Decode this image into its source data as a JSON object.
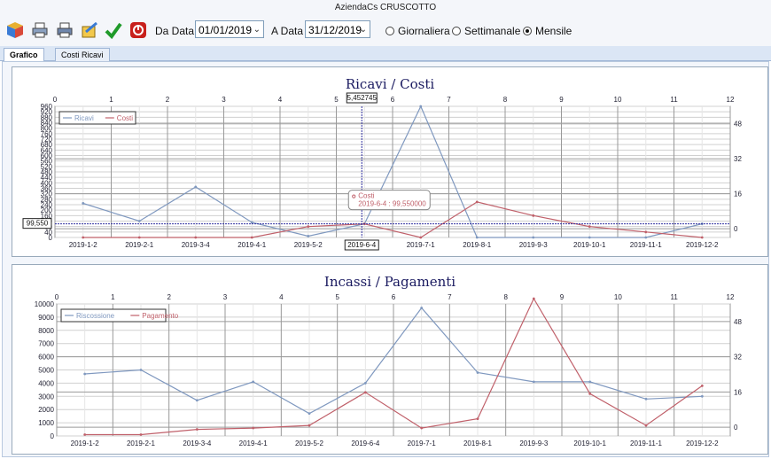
{
  "window": {
    "title": "AziendaCs CRUSCOTTO"
  },
  "toolbar": {
    "icons": [
      "cube-icon",
      "print-icon",
      "print-preview-icon",
      "export-icon",
      "confirm-check-icon",
      "power-icon"
    ],
    "da_data_label": "Da Data",
    "da_data_value": "01/01/2019",
    "a_data_label": "A Data",
    "a_data_value": "31/12/2019",
    "radio_giornaliera": "Giornaliera",
    "radio_settimanale": "Settimanale",
    "radio_mensile": "Mensile",
    "selected_period": "Mensile"
  },
  "tabs": [
    {
      "label": "Grafico",
      "active": true
    },
    {
      "label": "Costi Ricavi",
      "active": false
    }
  ],
  "colors": {
    "series_a": "#7f98bf",
    "series_b": "#c0606a",
    "grid": "#d0d0d0",
    "cursor": "#3030a0"
  },
  "chart_data": [
    {
      "type": "line",
      "title": "Ricavi / Costi",
      "categories": [
        "2019-1-2",
        "2019-2-1",
        "2019-3-4",
        "2019-4-1",
        "2019-5-2",
        "2019-6-4",
        "2019-7-1",
        "2019-8-1",
        "2019-9-3",
        "2019-10-1",
        "2019-11-1",
        "2019-12-2"
      ],
      "series": [
        {
          "name": "Ricavi",
          "values": [
            250,
            120,
            370,
            110,
            10,
            100,
            960,
            0,
            0,
            0,
            0,
            100
          ]
        },
        {
          "name": "Costi",
          "values": [
            0,
            0,
            0,
            0,
            80,
            99.55,
            0,
            260,
            160,
            80,
            40,
            0
          ]
        }
      ],
      "ylim": [
        0,
        960
      ],
      "yticks": [
        0,
        40,
        80,
        120,
        160,
        200,
        240,
        280,
        320,
        360,
        400,
        440,
        480,
        520,
        560,
        600,
        640,
        680,
        720,
        760,
        800,
        840,
        880,
        920,
        960
      ],
      "ytick_labels": [
        "0",
        "40",
        "80",
        "120",
        "160",
        "200",
        "240",
        "280",
        "320",
        "360",
        "400",
        "440",
        "480",
        "520",
        "560",
        "600",
        "640",
        "680",
        "720",
        "760",
        "800",
        "840",
        "880",
        "920",
        "960"
      ],
      "ylim_secondary": [
        -4,
        56
      ],
      "ytick_labels_secondary": [
        "0",
        "16",
        "32",
        "48"
      ],
      "xtop_labels": [
        "0",
        "1",
        "2",
        "3",
        "4",
        "5",
        "6",
        "7",
        "8",
        "9",
        "10",
        "11",
        "12"
      ],
      "legend": "top-left",
      "cursor": {
        "x": 5.452745,
        "x_label": "5,452745",
        "y": 99.55,
        "y_label": "99,550",
        "date_label": "2019-6-4"
      },
      "tooltip": {
        "series": "Costi",
        "text": "2019-6-4 : 99,550000"
      }
    },
    {
      "type": "line",
      "title": "Incassi / Pagamenti",
      "categories": [
        "2019-1-2",
        "2019-2-1",
        "2019-3-4",
        "2019-4-1",
        "2019-5-2",
        "2019-6-4",
        "2019-7-1",
        "2019-8-1",
        "2019-9-3",
        "2019-10-1",
        "2019-11-1",
        "2019-12-2"
      ],
      "series": [
        {
          "name": "Riscossione",
          "values": [
            4700,
            5000,
            2700,
            4100,
            1700,
            4000,
            9700,
            4800,
            4100,
            4100,
            2800,
            3000
          ]
        },
        {
          "name": "Pagamento",
          "values": [
            100,
            100,
            500,
            600,
            800,
            3300,
            600,
            1300,
            10400,
            3200,
            800,
            3800
          ]
        }
      ],
      "ylim": [
        0,
        10000
      ],
      "yticks": [
        0,
        1000,
        2000,
        3000,
        4000,
        5000,
        6000,
        7000,
        8000,
        9000,
        10000
      ],
      "ytick_labels": [
        "0",
        "1000",
        "2000",
        "3000",
        "4000",
        "5000",
        "6000",
        "7000",
        "8000",
        "9000",
        "10000"
      ],
      "ylim_secondary": [
        -4,
        56
      ],
      "ytick_labels_secondary": [
        "0",
        "16",
        "32",
        "48"
      ],
      "xtop_labels": [
        "0",
        "1",
        "2",
        "3",
        "4",
        "5",
        "6",
        "7",
        "8",
        "9",
        "10",
        "11",
        "12"
      ],
      "legend": "top-left"
    }
  ]
}
